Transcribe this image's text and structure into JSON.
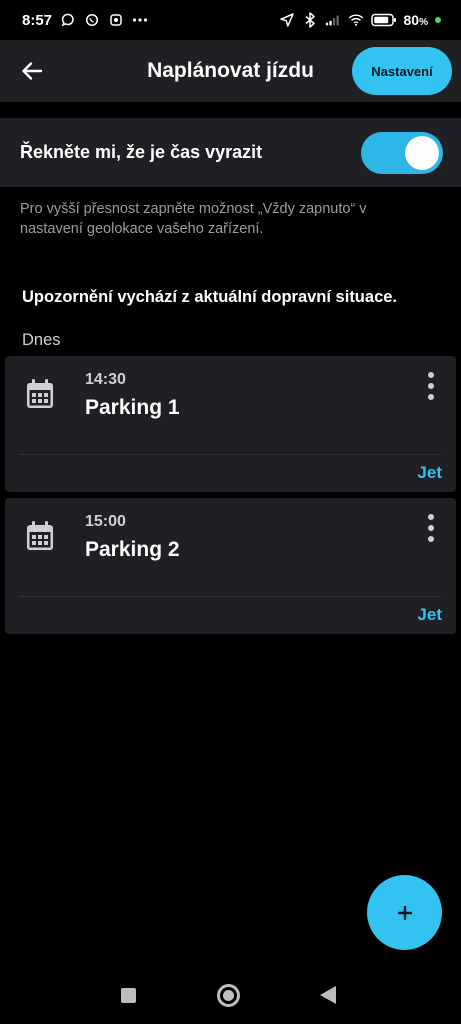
{
  "status_bar": {
    "time": "8:57",
    "battery_percent": "80",
    "battery_suffix": "%",
    "left_icons": [
      "chat-bubble-icon",
      "whatsapp-icon",
      "alarm-app-icon",
      "more-notifications-icon"
    ],
    "right_icons": [
      "location-arrow-icon",
      "bluetooth-icon",
      "signal-icon",
      "wifi-icon",
      "battery-icon"
    ]
  },
  "app_bar": {
    "title": "Naplánovat jízdu",
    "settings_label": "Nastavení"
  },
  "reminder": {
    "label": "Řekněte mi, že je čas vyrazit",
    "enabled": true
  },
  "hint": "Pro vyšší přesnost zapněte možnost „Vždy zapnuto“ v nastavení geolokace vašeho zařízení.",
  "info": "Upozornění vychází z aktuální dopravní situace.",
  "day": "Dnes",
  "trips": [
    {
      "time": "14:30",
      "name": "Parking 1",
      "action": "Jet"
    },
    {
      "time": "15:00",
      "name": "Parking 2",
      "action": "Jet"
    }
  ],
  "fab_icon": "plus-icon",
  "colors": {
    "accent": "#33c3f0",
    "surface": "#1f2024",
    "background": "#000000",
    "muted_text": "#9a9ca3"
  }
}
